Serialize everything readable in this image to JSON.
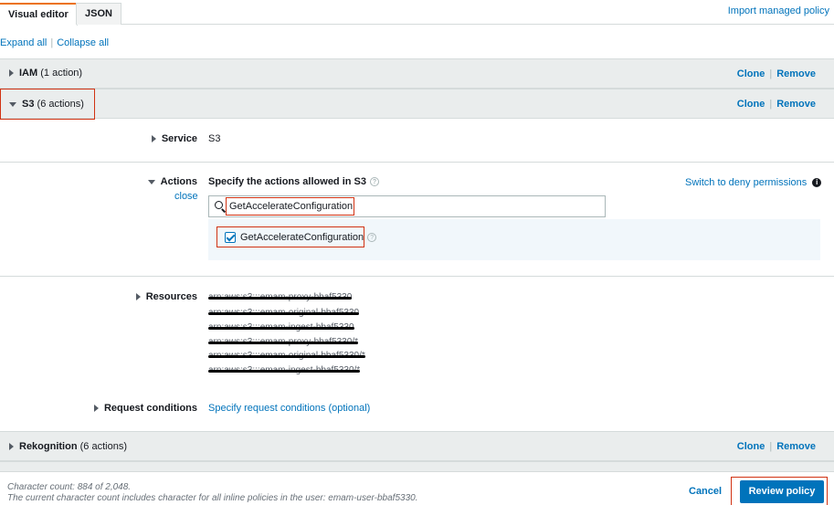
{
  "tabs": [
    {
      "label": "Visual editor",
      "active": true
    },
    {
      "label": "JSON",
      "active": false
    }
  ],
  "import_link": "Import managed policy",
  "expand_all": "Expand all",
  "collapse_all": "Collapse all",
  "sections": {
    "iam": {
      "service": "IAM",
      "count": "(1 action)",
      "expanded": false
    },
    "s3": {
      "service": "S3",
      "count": "(6 actions)",
      "expanded": true
    },
    "rekognition": {
      "service": "Rekognition",
      "count": "(6 actions)",
      "expanded": false
    }
  },
  "clone_label": "Clone",
  "remove_label": "Remove",
  "service_row": {
    "label": "Service",
    "value": "S3"
  },
  "actions_row": {
    "label": "Actions",
    "close": "close",
    "heading": "Specify the actions allowed in S3",
    "switch_deny": "Switch to deny permissions",
    "search_value": "GetAccelerateConfiguration",
    "result_label": "GetAccelerateConfiguration",
    "result_checked": true
  },
  "resources_row": {
    "label": "Resources",
    "arns": [
      "arn:aws:s3:::emam-proxy-bbaf5330",
      "arn:aws:s3:::emam-original-bbaf5330",
      "arn:aws:s3:::emam-ingest-bbaf5330",
      "arn:aws:s3:::emam-proxy-bbaf5330/*",
      "arn:aws:s3:::emam-original-bbaf5330/*",
      "arn:aws:s3:::emam-ingest-bbaf5330/*"
    ]
  },
  "request_conditions": {
    "label": "Request conditions",
    "link": "Specify request conditions (optional)"
  },
  "footer": {
    "count_line": "Character count: 884 of 2,048.",
    "note_line": "The current character count includes character for all inline policies in the user: emam-user-bbaf5330.",
    "cancel": "Cancel",
    "review": "Review policy"
  },
  "colors": {
    "link": "#0073bb",
    "primary_button": "#0073bb",
    "highlight_border": "#d13212",
    "tab_accent": "#ec7211"
  }
}
